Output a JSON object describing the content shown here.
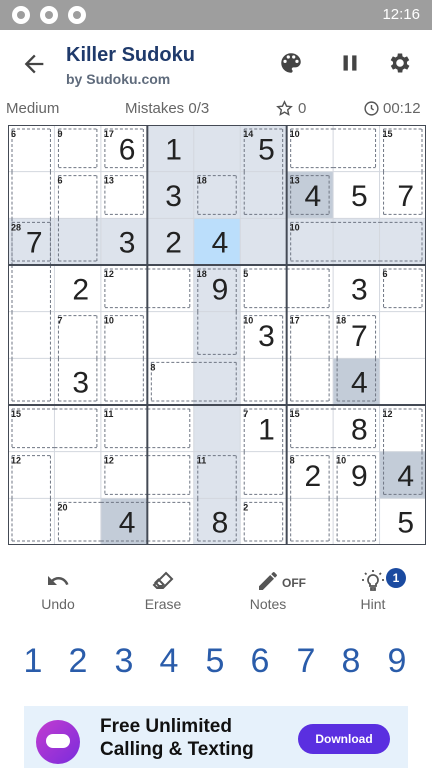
{
  "status": {
    "time": "12:16"
  },
  "header": {
    "title": "Killer Sudoku",
    "subtitle": "by Sudoku.com"
  },
  "info": {
    "difficulty": "Medium",
    "mistakes": "Mistakes 0/3",
    "score": "0",
    "timer": "00:12"
  },
  "board": {
    "values": [
      [
        0,
        0,
        6,
        1,
        0,
        5,
        0,
        0,
        0
      ],
      [
        0,
        0,
        0,
        3,
        0,
        0,
        4,
        5,
        7
      ],
      [
        7,
        0,
        3,
        2,
        4,
        0,
        0,
        0,
        0
      ],
      [
        0,
        2,
        0,
        0,
        9,
        0,
        0,
        3,
        0
      ],
      [
        0,
        0,
        0,
        0,
        0,
        3,
        0,
        7,
        0
      ],
      [
        0,
        3,
        0,
        0,
        0,
        0,
        0,
        4,
        0
      ],
      [
        0,
        0,
        0,
        0,
        0,
        1,
        0,
        8,
        0
      ],
      [
        0,
        0,
        0,
        0,
        0,
        0,
        2,
        9,
        4
      ],
      [
        0,
        0,
        4,
        0,
        8,
        0,
        0,
        0,
        5
      ]
    ],
    "selected": [
      2,
      4
    ],
    "highlight_color": "#dde3ec",
    "same_value_color": "#c3ccd8",
    "selected_color": "#bbdefb",
    "cages": [
      {
        "sum": "6",
        "cells": [
          [
            0,
            0
          ],
          [
            1,
            0
          ],
          [
            2,
            0
          ]
        ]
      },
      {
        "sum": "9",
        "cells": [
          [
            0,
            1
          ]
        ]
      },
      {
        "sum": "17",
        "cells": [
          [
            0,
            2
          ]
        ]
      },
      {
        "sum": "14",
        "cells": [
          [
            0,
            5
          ],
          [
            1,
            5
          ]
        ]
      },
      {
        "sum": "10",
        "cells": [
          [
            0,
            6
          ],
          [
            0,
            7
          ]
        ]
      },
      {
        "sum": "15",
        "cells": [
          [
            0,
            8
          ],
          [
            1,
            8
          ]
        ]
      },
      {
        "sum": "6",
        "cells": [
          [
            1,
            1
          ],
          [
            2,
            1
          ]
        ]
      },
      {
        "sum": "13",
        "cells": [
          [
            1,
            2
          ]
        ]
      },
      {
        "sum": "18",
        "cells": [
          [
            1,
            4
          ]
        ]
      },
      {
        "sum": "13",
        "cells": [
          [
            1,
            6
          ]
        ]
      },
      {
        "sum": "28",
        "cells": [
          [
            2,
            0
          ],
          [
            3,
            0
          ],
          [
            4,
            0
          ],
          [
            5,
            0
          ]
        ]
      },
      {
        "sum": "10",
        "cells": [
          [
            2,
            6
          ],
          [
            2,
            7
          ],
          [
            2,
            8
          ]
        ]
      },
      {
        "sum": "12",
        "cells": [
          [
            3,
            2
          ],
          [
            3,
            3
          ]
        ]
      },
      {
        "sum": "18",
        "cells": [
          [
            3,
            4
          ],
          [
            4,
            4
          ]
        ]
      },
      {
        "sum": "5",
        "cells": [
          [
            3,
            5
          ],
          [
            3,
            6
          ]
        ]
      },
      {
        "sum": "6",
        "cells": [
          [
            3,
            8
          ]
        ]
      },
      {
        "sum": "7",
        "cells": [
          [
            4,
            1
          ],
          [
            5,
            1
          ]
        ]
      },
      {
        "sum": "10",
        "cells": [
          [
            4,
            2
          ],
          [
            5,
            2
          ]
        ]
      },
      {
        "sum": "10",
        "cells": [
          [
            4,
            5
          ],
          [
            5,
            5
          ]
        ]
      },
      {
        "sum": "17",
        "cells": [
          [
            4,
            6
          ],
          [
            5,
            6
          ]
        ]
      },
      {
        "sum": "18",
        "cells": [
          [
            4,
            7
          ],
          [
            5,
            7
          ]
        ]
      },
      {
        "sum": "8",
        "cells": [
          [
            5,
            3
          ],
          [
            5,
            4
          ]
        ]
      },
      {
        "sum": "15",
        "cells": [
          [
            6,
            0
          ],
          [
            6,
            1
          ]
        ]
      },
      {
        "sum": "11",
        "cells": [
          [
            6,
            2
          ],
          [
            6,
            3
          ]
        ]
      },
      {
        "sum": "7",
        "cells": [
          [
            6,
            5
          ],
          [
            7,
            5
          ]
        ]
      },
      {
        "sum": "15",
        "cells": [
          [
            6,
            6
          ],
          [
            6,
            7
          ]
        ]
      },
      {
        "sum": "12",
        "cells": [
          [
            6,
            8
          ],
          [
            7,
            8
          ]
        ]
      },
      {
        "sum": "12",
        "cells": [
          [
            7,
            0
          ],
          [
            8,
            0
          ]
        ]
      },
      {
        "sum": "12",
        "cells": [
          [
            7,
            2
          ],
          [
            7,
            3
          ]
        ]
      },
      {
        "sum": "11",
        "cells": [
          [
            7,
            4
          ],
          [
            8,
            4
          ]
        ]
      },
      {
        "sum": "8",
        "cells": [
          [
            7,
            6
          ],
          [
            8,
            6
          ]
        ]
      },
      {
        "sum": "10",
        "cells": [
          [
            7,
            7
          ],
          [
            8,
            7
          ]
        ]
      },
      {
        "sum": "20",
        "cells": [
          [
            8,
            1
          ],
          [
            8,
            2
          ],
          [
            8,
            3
          ]
        ]
      },
      {
        "sum": "2",
        "cells": [
          [
            8,
            5
          ]
        ]
      }
    ]
  },
  "tools": {
    "undo": "Undo",
    "erase": "Erase",
    "notes": "Notes",
    "notes_state": "OFF",
    "hint": "Hint",
    "hint_count": "1"
  },
  "numpad": [
    "1",
    "2",
    "3",
    "4",
    "5",
    "6",
    "7",
    "8",
    "9"
  ],
  "ad": {
    "line1": "Free Unlimited",
    "line2": "Calling & Texting",
    "button": "Download"
  }
}
